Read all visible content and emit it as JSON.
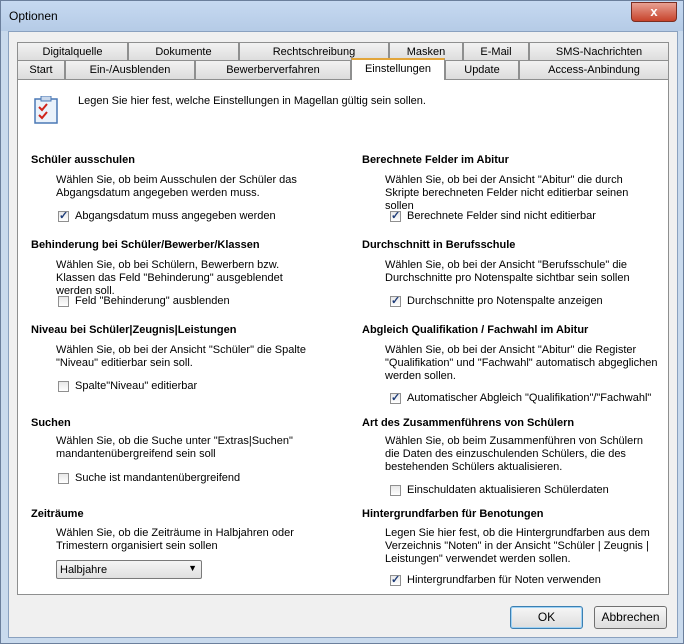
{
  "window": {
    "title": "Optionen",
    "close_glyph": "x"
  },
  "tabs_row1": [
    "Digitalquelle",
    "Dokumente",
    "Rechtschreibung",
    "Masken",
    "E-Mail",
    "SMS-Nachrichten"
  ],
  "tabs_row2": [
    "Start",
    "Ein-/Ausblenden",
    "Bewerberverfahren",
    "Einstellungen",
    "Update",
    "Access-Anbindung"
  ],
  "header": {
    "icon": "checklist-icon",
    "text": "Legen Sie hier fest, welche Einstellungen in Magellan gültig sein sollen."
  },
  "sections": {
    "s1": {
      "title": "Schüler ausschulen",
      "desc": "Wählen Sie, ob beim Ausschulen der Schüler das Abgangsdatum angegeben werden muss.",
      "checkbox": "Abgangsdatum muss angegeben werden",
      "checked": true
    },
    "s2": {
      "title": "Behinderung bei Schüler/Bewerber/Klassen",
      "desc": "Wählen Sie, ob bei Schülern, Bewerbern bzw. Klassen das Feld \"Behinderung\" ausgeblendet werden soll.",
      "checkbox": "Feld \"Behinderung\" ausblenden",
      "checked": false
    },
    "s3": {
      "title": "Niveau bei Schüler|Zeugnis|Leistungen",
      "desc": "Wählen Sie, ob bei der Ansicht \"Schüler\" die Spalte \"Niveau\" editierbar sein soll.",
      "checkbox": "Spalte\"Niveau\" editierbar",
      "checked": false
    },
    "s4": {
      "title": "Suchen",
      "desc": "Wählen Sie, ob die Suche unter \"Extras|Suchen\" mandantenübergreifend sein soll",
      "checkbox": "Suche ist mandantenübergreifend",
      "checked": false
    },
    "s5": {
      "title": "Zeiträume",
      "desc": "Wählen Sie, ob die Zeiträume in Halbjahren oder Trimestern organisiert sein sollen",
      "select_value": "Halbjahre"
    },
    "s6": {
      "title": "Berechnete Felder im Abitur",
      "desc": "Wählen Sie, ob bei der Ansicht \"Abitur\" die durch Skripte berechneten Felder nicht editierbar seinen sollen",
      "checkbox": "Berechnete Felder sind nicht editierbar",
      "checked": true
    },
    "s7": {
      "title": "Durchschnitt in Berufsschule",
      "desc": "Wählen Sie, ob bei der Ansicht \"Berufsschule\" die Durchschnitte pro Notenspalte sichtbar sein sollen",
      "checkbox": "Durchschnitte pro Notenspalte anzeigen",
      "checked": true
    },
    "s8": {
      "title": "Abgleich Qualifikation / Fachwahl im Abitur",
      "desc": "Wählen Sie, ob bei der Ansicht \"Abitur\" die Register \"Qualifikation\" und \"Fachwahl\" automatisch abgeglichen werden sollen.",
      "checkbox": "Automatischer Abgleich \"Qualifikation\"/\"Fachwahl\"",
      "checked": true
    },
    "s9": {
      "title": "Art des Zusammenführens von Schülern",
      "desc": "Wählen Sie, ob beim Zusammenführen von Schülern die Daten des einzuschulenden Schülers, die des bestehenden Schülers aktualisieren.",
      "checkbox": "Einschuldaten aktualisieren Schülerdaten",
      "checked": false
    },
    "s10": {
      "title": "Hintergrundfarben für Benotungen",
      "desc": "Legen Sie hier fest, ob die Hintergrundfarben aus dem Verzeichnis \"Noten\" in der Ansicht \"Schüler | Zeugnis | Leistungen\" verwendet werden sollen.",
      "checkbox": "Hintergrundfarben für Noten verwenden",
      "checked": true
    }
  },
  "buttons": {
    "ok": "OK",
    "cancel": "Abbrechen"
  },
  "colors": {
    "active_tab_accent": "#e2a53a",
    "close_button": "#c7432b"
  }
}
